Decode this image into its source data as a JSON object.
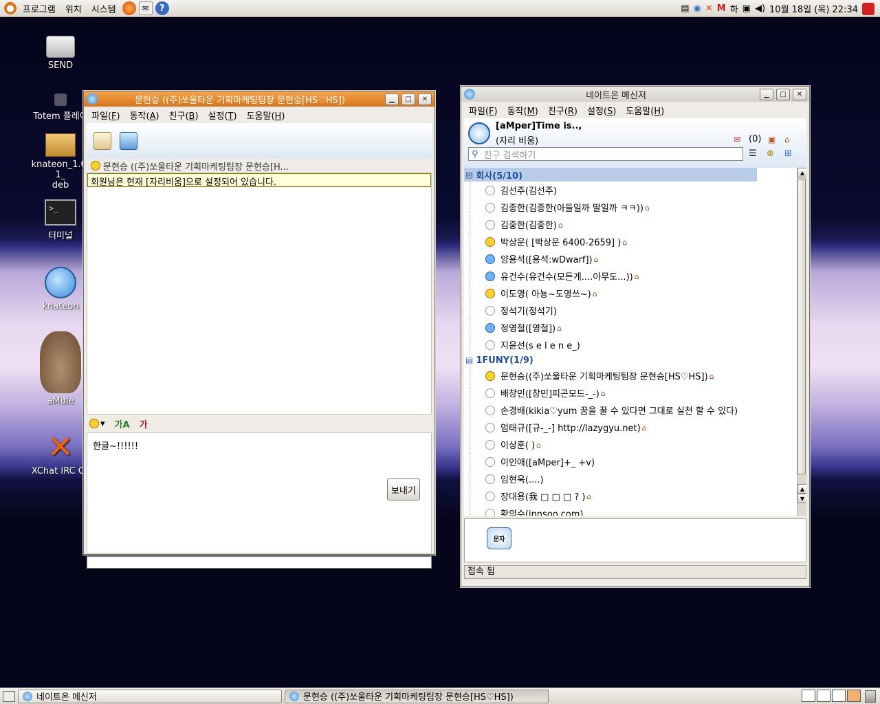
{
  "topbar": {
    "menus": [
      "프로그램",
      "위치",
      "시스템"
    ],
    "input_method": "하",
    "clock": "10월 18일 (목) 22:34"
  },
  "desktop": {
    "icons": [
      {
        "label": "SEND",
        "icon": "drive-icon"
      },
      {
        "label": "Totem 플레이",
        "icon": "totem-icon"
      },
      {
        "label": "knateon_1.0-1_",
        "label2": "deb",
        "icon": "package-icon"
      },
      {
        "label": "터미널",
        "icon": "terminal-icon"
      },
      {
        "label": "knateon",
        "icon": "knateon-icon"
      },
      {
        "label": "aMule",
        "icon": "amule-icon"
      },
      {
        "label": "XChat IRC Cli",
        "icon": "xchat-icon"
      }
    ]
  },
  "chat_window": {
    "title": "문현승 ((주)쏘울타운 기획마케팅팀장 문현승[HS♡HS])",
    "menus": [
      {
        "label": "파일",
        "key": "F"
      },
      {
        "label": "동작",
        "key": "A"
      },
      {
        "label": "친구",
        "key": "B"
      },
      {
        "label": "설정",
        "key": "T"
      },
      {
        "label": "도움말",
        "key": "H"
      }
    ],
    "partner": "문현승 ((주)쏘울타운 기획마케팅팀장 문현승[H...",
    "status_notice": "회원님은 현재 [자리비움]으로 설정되어 있습니다.",
    "format_font": "가A",
    "format_color": "가",
    "input_text": "한글~!!!!!!",
    "send_label": "보내기"
  },
  "messenger_window": {
    "title": "네이트온 메신저",
    "menus": [
      {
        "label": "파일",
        "key": "F"
      },
      {
        "label": "동작",
        "key": "M"
      },
      {
        "label": "친구",
        "key": "R"
      },
      {
        "label": "설정",
        "key": "S"
      },
      {
        "label": "도움말",
        "key": "H"
      }
    ],
    "profile_name": "[aMper]Time is..,",
    "profile_status": "(자리 비움)",
    "mail_count": "(0)",
    "search_placeholder": "친구 검색하기",
    "groups": [
      {
        "name": "회사(5/10)",
        "buddies": [
          {
            "text": "김선주(김선주)",
            "status": "off",
            "home": false
          },
          {
            "text": "김종한(김종한(아들일까 딸일까 ㅋㅋ))",
            "status": "off",
            "home": true
          },
          {
            "text": "김중한(김중한)",
            "status": "off",
            "home": true
          },
          {
            "text": "박상운( [박상운 6400-2659] )",
            "status": "on",
            "home": true
          },
          {
            "text": "양용석([용석:wDwarf])",
            "status": "blue",
            "home": true
          },
          {
            "text": "유건수(유건수(모든게....아무도...))",
            "status": "blue",
            "home": true
          },
          {
            "text": "이도영( 아뇽~도영쓰~)",
            "status": "on",
            "home": true
          },
          {
            "text": "정석기(정석기)",
            "status": "off",
            "home": false
          },
          {
            "text": "정영철([영철])",
            "status": "blue",
            "home": true
          },
          {
            "text": "지윤선(s e l e n e_)",
            "status": "off",
            "home": false
          }
        ]
      },
      {
        "name": "1FUNY(1/9)",
        "buddies": [
          {
            "text": "문현승((주)쏘울타운 기획마케팅팀장 문현승[HS♡HS])",
            "status": "on",
            "home": true
          },
          {
            "text": "배창민([창민]피곤모드-_-)",
            "status": "off",
            "home": true
          },
          {
            "text": "손경배(kikia♡yum 꿈을 꿀 수 있다면 그대로 실천 할 수 있다)",
            "status": "off",
            "home": false
          },
          {
            "text": "엄태규([규-_-] http://lazygyu.net)",
            "status": "off",
            "home": true
          },
          {
            "text": "이상훈( )",
            "status": "off",
            "home": true
          },
          {
            "text": "이인애([aMper]+_ +v)",
            "status": "off",
            "home": false
          },
          {
            "text": "임현욱(....)",
            "status": "off",
            "home": false
          },
          {
            "text": "장대용(我 □ □ □ ? )",
            "status": "off",
            "home": true
          },
          {
            "text": "황의수(innsoo.com)",
            "status": "off",
            "home": false
          }
        ]
      }
    ],
    "sms_label": "문자",
    "statusbar": "접속 됨"
  },
  "taskbar": {
    "tasks": [
      "네이트온 메신저",
      "문현승 ((주)쏘울타운 기획마케팅팀장 문현승[HS♡HS])"
    ]
  }
}
